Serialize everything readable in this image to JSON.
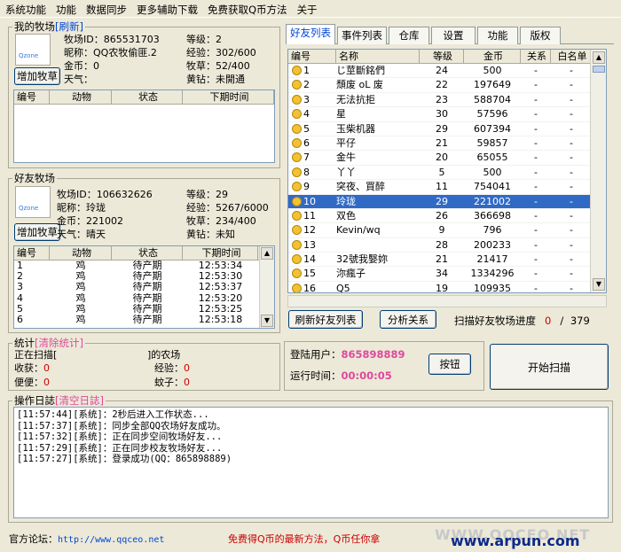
{
  "menu": [
    "系统功能",
    "功能",
    "数据同步",
    "更多辅助下载",
    "免费获取Q币方法",
    "关于"
  ],
  "myfarm": {
    "title": "我的牧场",
    "refresh": "[刷新]",
    "add_button": "增加牧草",
    "avatar_text": "Qzone",
    "id_label": "牧场ID：",
    "id": "865531703",
    "nick_label": "昵称：",
    "nick": "QQ农牧偷匪.2",
    "gold_label": "金币：",
    "gold": "0",
    "weather_label": "天气：",
    "weather": "",
    "level_label": "等级：",
    "level": "2",
    "exp_label": "经验：",
    "exp": "302/600",
    "grass_label": "牧草：",
    "grass": "52/400",
    "diamond_label": "黄钻：",
    "diamond": "未開通",
    "columns": [
      "编号",
      "动物",
      "状态",
      "下期时间"
    ]
  },
  "friendfarm": {
    "title": "好友牧场",
    "add_button": "增加牧草",
    "avatar_text": "Qzone",
    "id_label": "牧场ID：",
    "id": "106632626",
    "nick_label": "昵称：",
    "nick": "玲珑",
    "gold_label": "金币：",
    "gold": "221002",
    "weather_label": "天气：",
    "weather": "晴天",
    "level_label": "等级：",
    "level": "29",
    "exp_label": "经验：",
    "exp": "5267/6000",
    "grass_label": "牧草：",
    "grass": "234/400",
    "diamond_label": "黄钻：",
    "diamond": "未知",
    "columns": [
      "编号",
      "动物",
      "状态",
      "下期时间"
    ],
    "rows": [
      [
        "1",
        "鸡",
        "待产期",
        "12:53:34"
      ],
      [
        "2",
        "鸡",
        "待产期",
        "12:53:30"
      ],
      [
        "3",
        "鸡",
        "待产期",
        "12:53:37"
      ],
      [
        "4",
        "鸡",
        "待产期",
        "12:53:20"
      ],
      [
        "5",
        "鸡",
        "待产期",
        "12:53:25"
      ],
      [
        "6",
        "鸡",
        "待产期",
        "12:53:18"
      ]
    ]
  },
  "tabs": [
    "好友列表",
    "事件列表",
    "仓库",
    "设置",
    "功能",
    "版权"
  ],
  "friends": {
    "columns": [
      "编号",
      "名称",
      "等级",
      "金币",
      "关系",
      "白名单"
    ],
    "rows": [
      [
        "1",
        "じ莖斷銘們",
        "24",
        "500",
        "-",
        "-"
      ],
      [
        "2",
        "頹废 oL 废",
        "22",
        "197649",
        "-",
        "-"
      ],
      [
        "3",
        "无法抗拒",
        "23",
        "588704",
        "-",
        "-"
      ],
      [
        "4",
        "星",
        "30",
        "57596",
        "-",
        "-"
      ],
      [
        "5",
        "玉柴机器",
        "29",
        "607394",
        "-",
        "-"
      ],
      [
        "6",
        "平仔",
        "21",
        "59857",
        "-",
        "-"
      ],
      [
        "7",
        "金牛",
        "20",
        "65055",
        "-",
        "-"
      ],
      [
        "8",
        "丫丫",
        "5",
        "500",
        "-",
        "-"
      ],
      [
        "9",
        "突夜、買醉",
        "11",
        "754041",
        "-",
        "-"
      ],
      [
        "10",
        "玲珑",
        "29",
        "221002",
        "-",
        "-"
      ],
      [
        "11",
        "双色",
        "26",
        "366698",
        "-",
        "-"
      ],
      [
        "12",
        "Kevin/wq",
        "9",
        "796",
        "-",
        "-"
      ],
      [
        "13",
        "",
        "28",
        "200233",
        "-",
        "-"
      ],
      [
        "14",
        "32號我嫛妳",
        "21",
        "21417",
        "-",
        "-"
      ],
      [
        "15",
        "沵瘋子",
        "34",
        "1334296",
        "-",
        "-"
      ],
      [
        "16",
        "Q5",
        "19",
        "109935",
        "-",
        "-"
      ],
      [
        "17",
        "…",
        "",
        "",
        "",
        ""
      ]
    ],
    "selected_index": 9,
    "refresh_button": "刷新好友列表",
    "analyze_button": "分析关系",
    "progress_label": "扫描好友牧场进度",
    "progress_current": "0",
    "progress_sep": "/",
    "progress_total": "379"
  },
  "stats": {
    "title": "统计",
    "clear": "[清除统计]",
    "scanning_label": "正在扫描[",
    "scanning_suffix": "]的农场",
    "harvest_label": "收获：",
    "harvest": "0",
    "exp_label": "经验：",
    "exp": "0",
    "poop_label": "便便：",
    "poop": "0",
    "mosquito_label": "蚊子：",
    "mosquito": "0"
  },
  "login": {
    "user_label": "登陆用户：",
    "user": "865898889",
    "time_label": "运行时间：",
    "time": "00:00:05",
    "button": "按钮",
    "start_button": "开始扫描"
  },
  "log": {
    "title": "操作日誌",
    "clear": "[清空日誌]",
    "lines": [
      "[11:57:44][系统]：2秒后进入工作状态...",
      "[11:57:37][系统]：同步全部QQ农场好友成功。",
      "[11:57:32][系统]：正在同步空间牧场好友...",
      "[11:57:29][系统]：正在同步校友牧场好友...",
      "[11:57:27][系统]：登录成功(QQ：865898889)"
    ]
  },
  "footer": {
    "forum_label": "官方论坛：",
    "forum_url": "http://www.qqceo.net",
    "promo": "免费得Q币的最新方法，Q币任你拿",
    "watermark_top": "WWW.QQCEO.NET",
    "watermark": "www.arpun.com"
  },
  "colors": {
    "accent": "#0046d5",
    "pink": "#e0489c",
    "red": "#cc0000",
    "selection": "#316ac5",
    "window": "#ece9d8"
  }
}
